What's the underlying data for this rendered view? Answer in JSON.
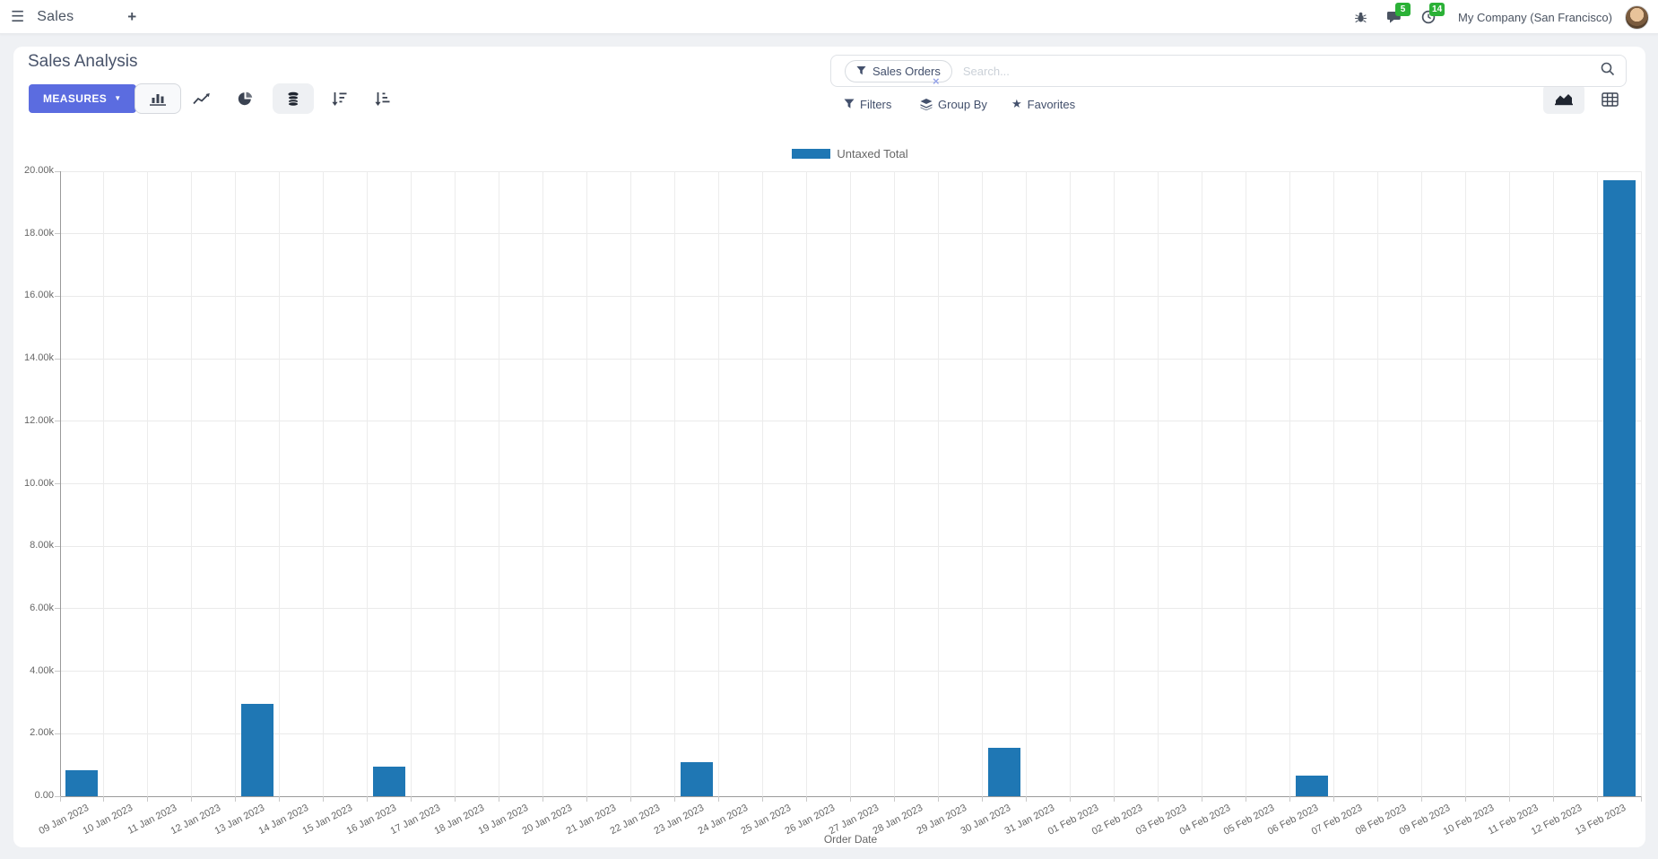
{
  "icons": {
    "hamburger": "☰",
    "plus": "+",
    "caret": "▼",
    "star": "★",
    "facet_remove": "×"
  },
  "navbar": {
    "app_name": "Sales",
    "messages_badge": "5",
    "activities_badge": "14",
    "company": "My Company (San Francisco)"
  },
  "control_panel": {
    "title": "Sales Analysis",
    "measures_label": "MEASURES",
    "search": {
      "facet": "Sales Orders",
      "placeholder": "Search..."
    },
    "filters_label": "Filters",
    "group_by_label": "Group By",
    "favorites_label": "Favorites"
  },
  "chart_data": {
    "type": "bar",
    "title": "",
    "legend": [
      "Untaxed Total"
    ],
    "series_color": "#1f77b4",
    "xlabel": "Order Date",
    "ylim": [
      0,
      20000
    ],
    "ytick_step": 2000,
    "ytick_labels": [
      "0.00",
      "2.00k",
      "4.00k",
      "6.00k",
      "8.00k",
      "10.00k",
      "12.00k",
      "14.00k",
      "16.00k",
      "18.00k",
      "20.00k"
    ],
    "grid": true,
    "legend_position": "top",
    "categories": [
      "09 Jan 2023",
      "10 Jan 2023",
      "11 Jan 2023",
      "12 Jan 2023",
      "13 Jan 2023",
      "14 Jan 2023",
      "15 Jan 2023",
      "16 Jan 2023",
      "17 Jan 2023",
      "18 Jan 2023",
      "19 Jan 2023",
      "20 Jan 2023",
      "21 Jan 2023",
      "22 Jan 2023",
      "23 Jan 2023",
      "24 Jan 2023",
      "25 Jan 2023",
      "26 Jan 2023",
      "27 Jan 2023",
      "28 Jan 2023",
      "29 Jan 2023",
      "30 Jan 2023",
      "31 Jan 2023",
      "01 Feb 2023",
      "02 Feb 2023",
      "03 Feb 2023",
      "04 Feb 2023",
      "05 Feb 2023",
      "06 Feb 2023",
      "07 Feb 2023",
      "08 Feb 2023",
      "09 Feb 2023",
      "10 Feb 2023",
      "11 Feb 2023",
      "12 Feb 2023",
      "13 Feb 2023"
    ],
    "values": [
      820,
      0,
      0,
      0,
      2950,
      0,
      0,
      950,
      0,
      0,
      0,
      0,
      0,
      0,
      1100,
      0,
      0,
      0,
      0,
      0,
      0,
      1550,
      0,
      0,
      0,
      0,
      0,
      0,
      660,
      0,
      0,
      0,
      0,
      0,
      0,
      19720
    ]
  }
}
